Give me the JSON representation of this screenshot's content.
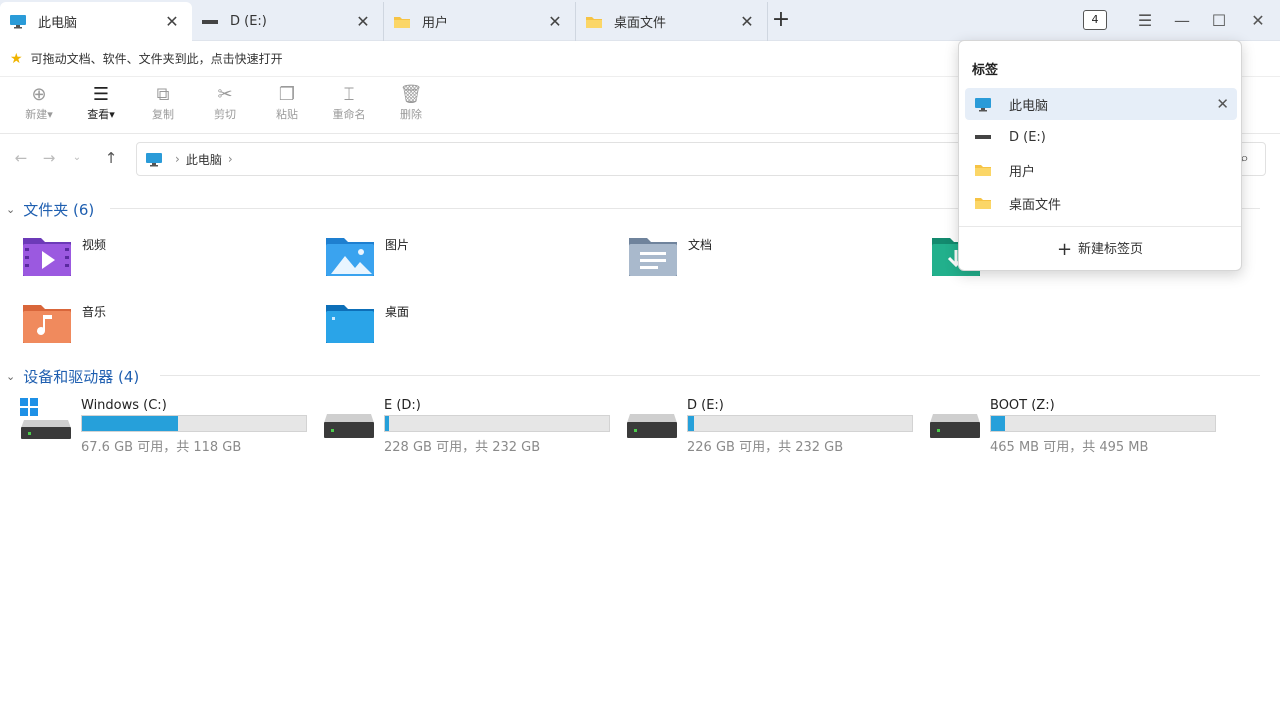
{
  "tabs": [
    {
      "title": "此电脑",
      "icon": "pc-icon"
    },
    {
      "title": "D (E:)",
      "icon": "drive-icon"
    },
    {
      "title": "用户",
      "icon": "folder-icon"
    },
    {
      "title": "桌面文件",
      "icon": "folder-icon"
    }
  ],
  "tab_count": "4",
  "bookmark_hint": "可拖动文档、软件、文件夹到此，点击快速打开",
  "toolbar": {
    "new": "新建",
    "view": "查看",
    "copy": "复制",
    "cut": "剪切",
    "paste": "粘贴",
    "rename": "重命名",
    "delete": "删除"
  },
  "address": {
    "location": "此电脑"
  },
  "folders_section": {
    "title": "文件夹 (6)",
    "items": [
      {
        "label": "视频"
      },
      {
        "label": "图片"
      },
      {
        "label": "文档"
      },
      {
        "label": "音乐"
      },
      {
        "label": "桌面"
      }
    ]
  },
  "drives_section": {
    "title": "设备和驱动器 (4)",
    "items": [
      {
        "name": "Windows (C:)",
        "status": "67.6 GB 可用，共 118 GB",
        "used_fraction": 0.427
      },
      {
        "name": "E (D:)",
        "status": "228 GB 可用，共 232 GB",
        "used_fraction": 0.017
      },
      {
        "name": "D (E:)",
        "status": "226 GB 可用，共 232 GB",
        "used_fraction": 0.026
      },
      {
        "name": "BOOT (Z:)",
        "status": "465 MB 可用，共 495 MB",
        "used_fraction": 0.061
      }
    ]
  },
  "popup": {
    "title": "标签",
    "items": [
      {
        "label": "此电脑"
      },
      {
        "label": "D (E:)"
      },
      {
        "label": "用户"
      },
      {
        "label": "桌面文件"
      }
    ],
    "new_tab": "新建标签页"
  }
}
